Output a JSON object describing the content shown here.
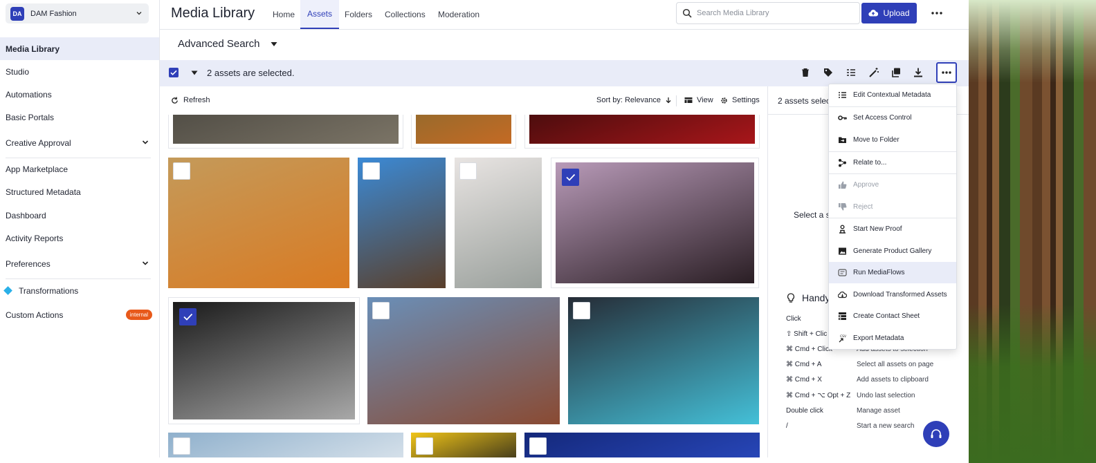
{
  "workspace": {
    "initials": "DA",
    "name": "DAM Fashion"
  },
  "sidebar": {
    "items": [
      {
        "label": "Media Library"
      },
      {
        "label": "Studio"
      },
      {
        "label": "Automations"
      },
      {
        "label": "Basic Portals"
      },
      {
        "label": "Creative Approval"
      },
      {
        "label": "App Marketplace"
      },
      {
        "label": "Structured Metadata"
      },
      {
        "label": "Dashboard"
      },
      {
        "label": "Activity Reports"
      },
      {
        "label": "Preferences"
      },
      {
        "label": "Transformations"
      },
      {
        "label": "Custom Actions",
        "badge": "internal"
      }
    ]
  },
  "header": {
    "title": "Media Library",
    "tabs": [
      {
        "label": "Home"
      },
      {
        "label": "Assets"
      },
      {
        "label": "Folders"
      },
      {
        "label": "Collections"
      },
      {
        "label": "Moderation"
      }
    ],
    "search_placeholder": "Search Media Library",
    "upload_label": "Upload"
  },
  "advanced_search": {
    "label": "Advanced Search"
  },
  "selection": {
    "text": "2 assets are selected."
  },
  "toolbar": {
    "refresh_label": "Refresh",
    "sort_label": "Sort by: Relevance",
    "view_label": "View",
    "settings_label": "Settings"
  },
  "right_panel": {
    "header": "2 assets selec",
    "select_prompt": "Select a s",
    "handy_title": "Handy",
    "shortcuts": [
      {
        "key": "Click",
        "desc": ""
      },
      {
        "key": "⇧ Shift + Clic",
        "desc": ""
      },
      {
        "key": "⌘ Cmd + Click",
        "desc": "Add assets to selection"
      },
      {
        "key": "⌘ Cmd + A",
        "desc": "Select all assets on page"
      },
      {
        "key": "⌘ Cmd + X",
        "desc": "Add assets to clipboard"
      },
      {
        "key": "⌘ Cmd + ⌥ Opt + Z",
        "desc": "Undo last selection"
      },
      {
        "key": "Double click",
        "desc": "Manage asset"
      },
      {
        "key": "/",
        "desc": "Start a new search"
      }
    ]
  },
  "menu": {
    "items": [
      {
        "label": "Edit Contextual Metadata",
        "icon": "metadata-list-icon"
      },
      {
        "label": "Set Access Control",
        "icon": "key-icon"
      },
      {
        "label": "Move to Folder",
        "icon": "folder-move-icon"
      },
      {
        "label": "Relate to...",
        "icon": "relate-icon"
      },
      {
        "label": "Approve",
        "icon": "thumbs-up-icon",
        "disabled": true
      },
      {
        "label": "Reject",
        "icon": "thumbs-down-icon",
        "disabled": true
      },
      {
        "label": "Start New Proof",
        "icon": "proof-icon"
      },
      {
        "label": "Generate Product Gallery",
        "icon": "gallery-icon"
      },
      {
        "label": "Run MediaFlows",
        "icon": "mediaflows-icon"
      },
      {
        "label": "Download Transformed Assets",
        "icon": "cloud-download-icon"
      },
      {
        "label": "Create Contact Sheet",
        "icon": "contact-sheet-icon"
      },
      {
        "label": "Export Metadata",
        "icon": "csv-export-icon"
      }
    ]
  },
  "assets": [
    {
      "name": "aerial-landscape",
      "selected": false,
      "colors": [
        "#4a4740",
        "#7b7466"
      ]
    },
    {
      "name": "autumn-leaves",
      "selected": false,
      "colors": [
        "#8a6a2e",
        "#c46a24"
      ]
    },
    {
      "name": "red-fruit",
      "selected": false,
      "colors": [
        "#3a0b0b",
        "#a8161a"
      ]
    },
    {
      "name": "spice-bags",
      "selected": false,
      "colors": [
        "#c49a5a",
        "#d97a22"
      ]
    },
    {
      "name": "wooden-house",
      "selected": false,
      "colors": [
        "#3b8ad6",
        "#5a3f2a"
      ]
    },
    {
      "name": "clothes-rack",
      "selected": false,
      "colors": [
        "#e8e4e2",
        "#9aa09c"
      ]
    },
    {
      "name": "hiker-silhouette",
      "selected": true,
      "colors": [
        "#b89ab8",
        "#2a1e24"
      ]
    },
    {
      "name": "car-radio",
      "selected": true,
      "colors": [
        "#1a1a1a",
        "#a8a8a8"
      ]
    },
    {
      "name": "woman-street",
      "selected": false,
      "colors": [
        "#6a8fb8",
        "#8a4a32"
      ]
    },
    {
      "name": "peace-light",
      "selected": false,
      "colors": [
        "#262c36",
        "#44c0d8"
      ]
    },
    {
      "name": "sky-clouds",
      "selected": false,
      "colors": [
        "#8fb0cc",
        "#dfe7ee"
      ]
    },
    {
      "name": "yellow-graphic",
      "selected": false,
      "colors": [
        "#f0c418",
        "#1c1c1c"
      ]
    },
    {
      "name": "blue-night",
      "selected": false,
      "colors": [
        "#14287a",
        "#2a4ac0"
      ]
    }
  ],
  "colors": {
    "accent": "#2f3fb8",
    "badge": "#e8591a"
  }
}
